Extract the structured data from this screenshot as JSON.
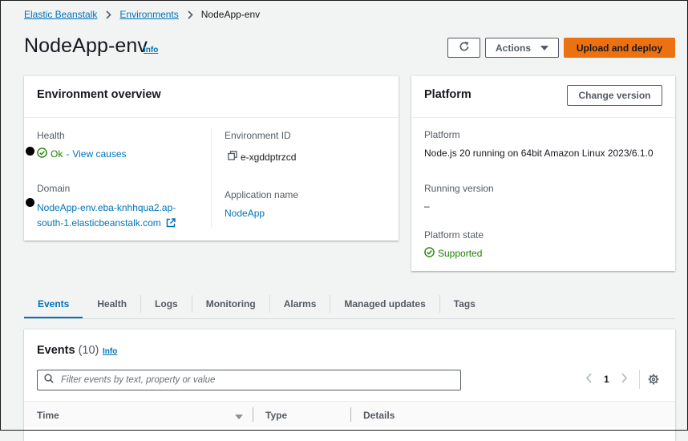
{
  "breadcrumb": {
    "items": [
      {
        "label": "Elastic Beanstalk"
      },
      {
        "label": "Environments"
      }
    ],
    "current": "NodeApp-env"
  },
  "header": {
    "title": "NodeApp-env",
    "info": "Info",
    "actions_label": "Actions",
    "primary_label": "Upload and deploy"
  },
  "overview": {
    "title": "Environment overview",
    "health_label": "Health",
    "health_status": "Ok",
    "health_sep": " - ",
    "health_link": "View causes",
    "domain_label": "Domain",
    "domain_line1": "NodeApp-env.eba-knhhqua2.ap-",
    "domain_line2": "south-1.elasticbeanstalk.com",
    "env_id_label": "Environment ID",
    "env_id": "e-xgddptrzcd",
    "app_name_label": "Application name",
    "app_name": "NodeApp"
  },
  "platform": {
    "title": "Platform",
    "change_label": "Change version",
    "platform_label": "Platform",
    "platform_value": "Node.js 20 running on 64bit Amazon Linux 2023/6.1.0",
    "running_label": "Running version",
    "running_value": "–",
    "state_label": "Platform state",
    "state_value": "Supported"
  },
  "tabs": [
    "Events",
    "Health",
    "Logs",
    "Monitoring",
    "Alarms",
    "Managed updates",
    "Tags"
  ],
  "events": {
    "title": "Events",
    "count": "(10)",
    "info": "Info",
    "search_placeholder": "Filter events by text, property or value",
    "page": "1",
    "columns": [
      "Time",
      "Type",
      "Details"
    ]
  },
  "colors": {
    "link": "#0073bb",
    "primary": "#ec7211",
    "success": "#1d8102",
    "background": "#f2f3f3"
  }
}
